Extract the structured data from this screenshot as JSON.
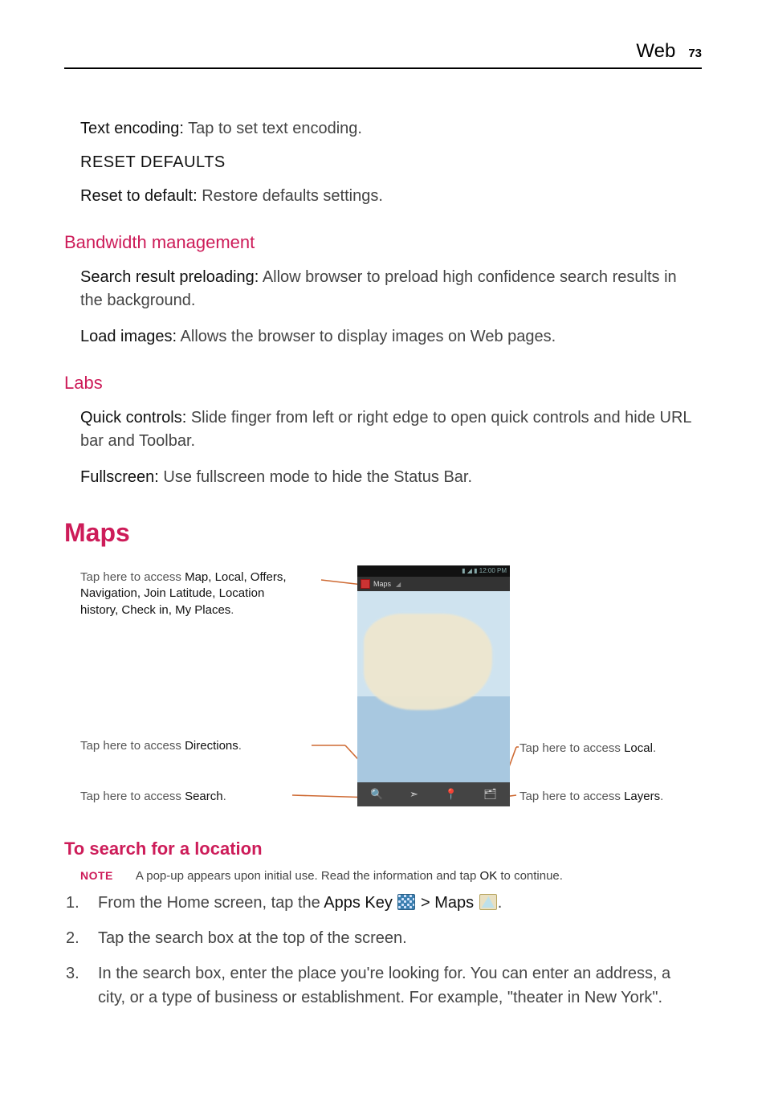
{
  "header": {
    "section": "Web",
    "page": "73"
  },
  "text_encoding": {
    "label": "Text encoding:",
    "desc": " Tap to set text encoding."
  },
  "reset_defaults_caps": "RESET DEFAULTS",
  "reset_default": {
    "label": "Reset to default:",
    "desc": " Restore defaults settings."
  },
  "bandwidth_h": "Bandwidth management",
  "search_preload": {
    "label": "Search result preloading:",
    "desc": " Allow browser to preload high confidence search results in the background."
  },
  "load_images": {
    "label": "Load images:",
    "desc": " Allows the browser to display images on Web pages."
  },
  "labs_h": "Labs",
  "quick_controls": {
    "label": "Quick controls:",
    "desc": " Slide finger from left or right edge to open quick controls and hide URL bar and Toolbar."
  },
  "fullscreen": {
    "label": "Fullscreen:",
    "desc": " Use fullscreen mode to hide the Status Bar."
  },
  "maps_h": "Maps",
  "phone_bar_text": "Maps",
  "callouts": {
    "menu_pre": "Tap here to access ",
    "menu_items": "Map, Local, Offers, Navigation, Join Latitude, Location history, Check in, My Places",
    "menu_suffix": ".",
    "directions_pre": "Tap here to access ",
    "directions_b": "Directions",
    "directions_suffix": ".",
    "search_pre": "Tap here to access ",
    "search_b": "Search",
    "search_suffix": ".",
    "local_pre": "Tap here to access ",
    "local_b": "Local",
    "local_suffix": ".",
    "layers_pre": "Tap here to access ",
    "layers_b": "Layers",
    "layers_suffix": "."
  },
  "search_loc_h": "To search for a location",
  "note": {
    "tag": "NOTE",
    "text_pre": "A pop-up appears upon initial use. Read the information and tap ",
    "ok": "OK",
    "text_post": " to continue."
  },
  "steps": {
    "s1_pre": "From the Home screen, tap the ",
    "s1_apps": "Apps Key",
    "s1_gt": " > ",
    "s1_maps": "Maps",
    "s1_end": ".",
    "s2": "Tap the search box at the top of the screen.",
    "s3": "In the search box, enter the place you're looking for. You can enter an address, a city, or a type of business or establishment. For example, \"theater in New York\"."
  }
}
